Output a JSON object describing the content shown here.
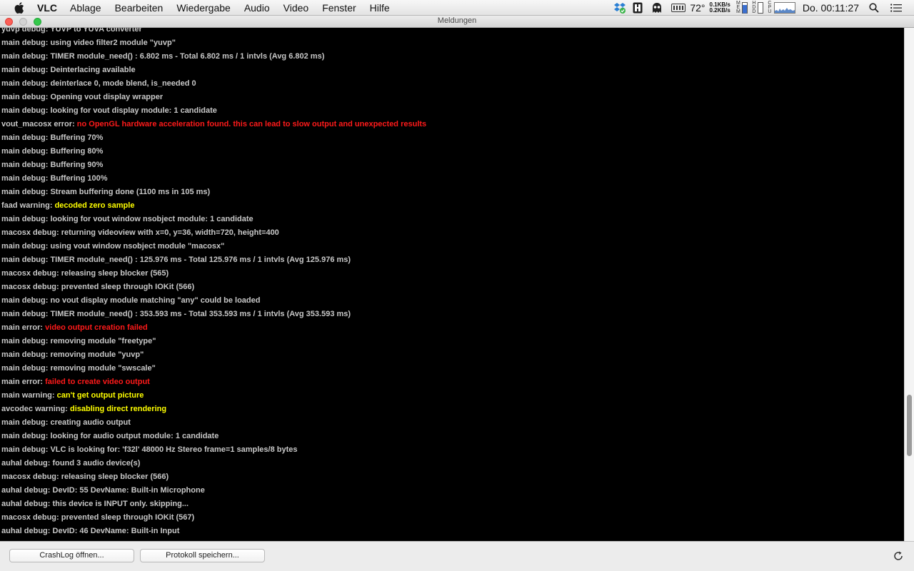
{
  "menubar": {
    "apple_icon": "apple-icon",
    "app_name": "VLC",
    "items": [
      "Ablage",
      "Bearbeiten",
      "Wiedergabe",
      "Audio",
      "Video",
      "Fenster",
      "Hilfe"
    ],
    "status": {
      "temperature": "72°",
      "net_up": "0.1KB/s",
      "net_down": "0.2KB/s",
      "mem_label": "MEM",
      "hdd_label": "HDD",
      "cpu_label": "CPU",
      "clock": "Do. 00:11:27"
    }
  },
  "window": {
    "title": "Meldungen"
  },
  "log": {
    "colors": {
      "debug": "#c8c8c8",
      "error": "#ff1a1a",
      "warning": "#ffff00",
      "background": "#000000"
    },
    "lines": [
      {
        "prefix": "yuvp debug:",
        "msg": "YUVP to YUVA converter",
        "level": "debug"
      },
      {
        "prefix": "main debug:",
        "msg": "using video filter2 module \"yuvp\"",
        "level": "debug"
      },
      {
        "prefix": "main debug:",
        "msg": "TIMER module_need() : 6.802 ms - Total 6.802 ms / 1 intvls (Avg 6.802 ms)",
        "level": "debug"
      },
      {
        "prefix": "main debug:",
        "msg": "Deinterlacing available",
        "level": "debug"
      },
      {
        "prefix": "main debug:",
        "msg": "deinterlace 0, mode blend, is_needed 0",
        "level": "debug"
      },
      {
        "prefix": "main debug:",
        "msg": "Opening vout display wrapper",
        "level": "debug"
      },
      {
        "prefix": "main debug:",
        "msg": "looking for vout display module: 1 candidate",
        "level": "debug"
      },
      {
        "prefix": "vout_macosx error:",
        "msg": "no OpenGL hardware acceleration found. this can lead to slow output and unexpected results",
        "level": "error"
      },
      {
        "prefix": "main debug:",
        "msg": "Buffering 70%",
        "level": "debug"
      },
      {
        "prefix": "main debug:",
        "msg": "Buffering 80%",
        "level": "debug"
      },
      {
        "prefix": "main debug:",
        "msg": "Buffering 90%",
        "level": "debug"
      },
      {
        "prefix": "main debug:",
        "msg": "Buffering 100%",
        "level": "debug"
      },
      {
        "prefix": "main debug:",
        "msg": "Stream buffering done (1100 ms in 105 ms)",
        "level": "debug"
      },
      {
        "prefix": "faad warning:",
        "msg": "decoded zero sample",
        "level": "warning"
      },
      {
        "prefix": "main debug:",
        "msg": "looking for vout window nsobject module: 1 candidate",
        "level": "debug"
      },
      {
        "prefix": "macosx debug:",
        "msg": "returning videoview with x=0, y=36, width=720, height=400",
        "level": "debug"
      },
      {
        "prefix": "main debug:",
        "msg": "using vout window nsobject module \"macosx\"",
        "level": "debug"
      },
      {
        "prefix": "main debug:",
        "msg": "TIMER module_need() : 125.976 ms - Total 125.976 ms / 1 intvls (Avg 125.976 ms)",
        "level": "debug"
      },
      {
        "prefix": "macosx debug:",
        "msg": "releasing sleep blocker (565)",
        "level": "debug"
      },
      {
        "prefix": "macosx debug:",
        "msg": "prevented sleep through IOKit (566)",
        "level": "debug"
      },
      {
        "prefix": "main debug:",
        "msg": "no vout display module matching \"any\" could be loaded",
        "level": "debug"
      },
      {
        "prefix": "main debug:",
        "msg": "TIMER module_need() : 353.593 ms - Total 353.593 ms / 1 intvls (Avg 353.593 ms)",
        "level": "debug"
      },
      {
        "prefix": "main error:",
        "msg": "video output creation failed",
        "level": "error"
      },
      {
        "prefix": "main debug:",
        "msg": "removing module \"freetype\"",
        "level": "debug"
      },
      {
        "prefix": "main debug:",
        "msg": "removing module \"yuvp\"",
        "level": "debug"
      },
      {
        "prefix": "main debug:",
        "msg": "removing module \"swscale\"",
        "level": "debug"
      },
      {
        "prefix": "main error:",
        "msg": "failed to create video output",
        "level": "error"
      },
      {
        "prefix": "main warning:",
        "msg": "can't get output picture",
        "level": "warning"
      },
      {
        "prefix": "avcodec warning:",
        "msg": "disabling direct rendering",
        "level": "warning"
      },
      {
        "prefix": "main debug:",
        "msg": "creating audio output",
        "level": "debug"
      },
      {
        "prefix": "main debug:",
        "msg": "looking for audio output module: 1 candidate",
        "level": "debug"
      },
      {
        "prefix": "main debug:",
        "msg": "VLC is looking for: 'f32l' 48000 Hz Stereo frame=1 samples/8 bytes",
        "level": "debug"
      },
      {
        "prefix": "auhal debug:",
        "msg": "found 3 audio device(s)",
        "level": "debug"
      },
      {
        "prefix": "macosx debug:",
        "msg": "releasing sleep blocker (566)",
        "level": "debug"
      },
      {
        "prefix": "auhal debug:",
        "msg": "DevID: 55 DevName: Built-in Microphone",
        "level": "debug"
      },
      {
        "prefix": "auhal debug:",
        "msg": "this device is INPUT only. skipping...",
        "level": "debug"
      },
      {
        "prefix": "macosx debug:",
        "msg": "prevented sleep through IOKit (567)",
        "level": "debug"
      },
      {
        "prefix": "auhal debug:",
        "msg": "DevID: 46 DevName: Built-in Input",
        "level": "debug"
      }
    ]
  },
  "footer": {
    "crashlog_label": "CrashLog öffnen...",
    "save_label": "Protokoll speichern...",
    "refresh_icon": "refresh-icon"
  }
}
